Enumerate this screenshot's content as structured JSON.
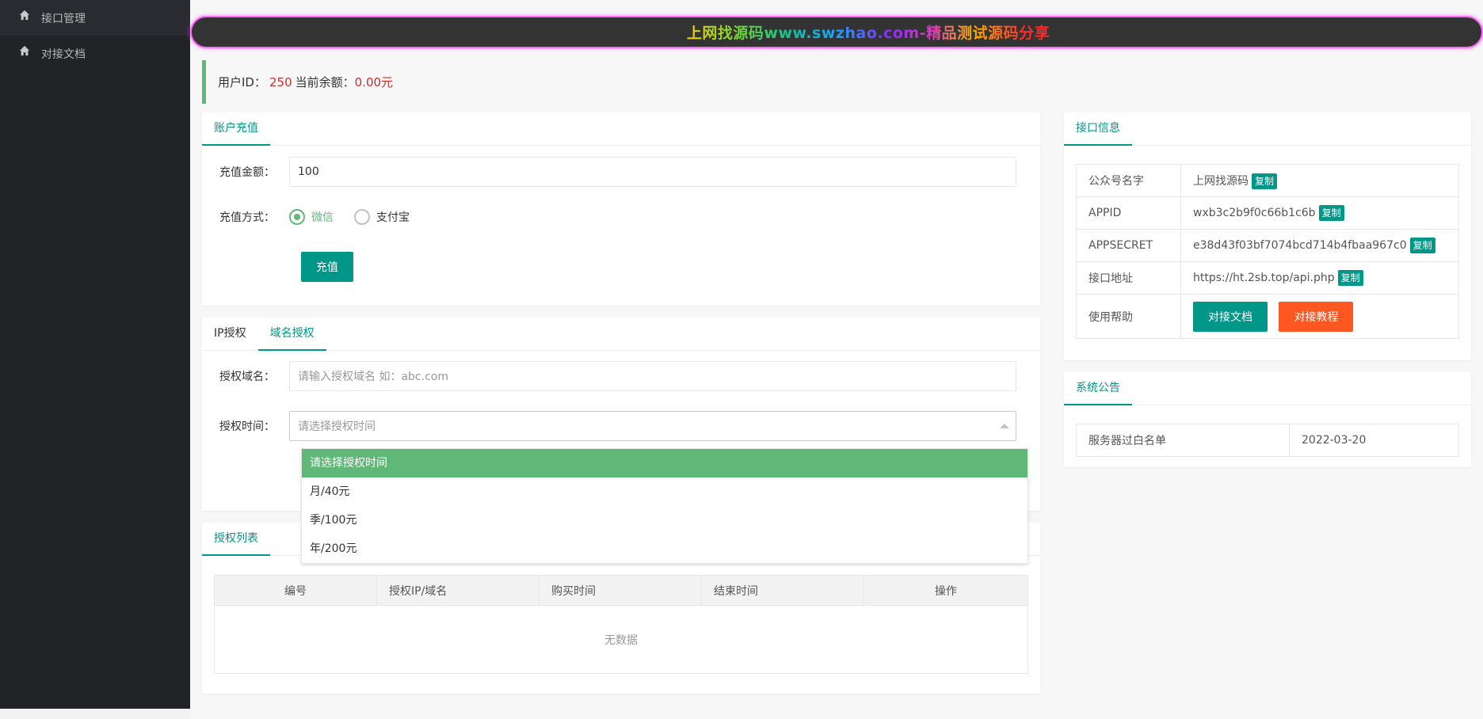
{
  "sidebar": {
    "items": [
      {
        "label": "接口管理"
      },
      {
        "label": "对接文档"
      }
    ]
  },
  "banner": {
    "text": "上网找源码www.swzhao.com-精品测试源码分享"
  },
  "user": {
    "id_label": "用户ID：",
    "id_value": "250",
    "balance_label": "当前余额：",
    "balance_value": "0.00元"
  },
  "recharge": {
    "tab": "账户充值",
    "amount_label": "充值金额：",
    "amount_value": "100",
    "method_label": "充值方式：",
    "methods": [
      "微信",
      "支付宝"
    ],
    "selected_method": "微信",
    "submit_label": "充值"
  },
  "auth": {
    "tabs": [
      "IP授权",
      "域名授权"
    ],
    "active_tab": "域名授权",
    "domain_label": "授权域名：",
    "domain_placeholder": "请输入授权域名 如：abc.com",
    "time_label": "授权时间：",
    "time_placeholder": "请选择授权时间",
    "time_options": [
      "请选择授权时间",
      "月/40元",
      "季/100元",
      "年/200元"
    ]
  },
  "auth_list": {
    "tab": "授权列表",
    "columns": [
      "编号",
      "授权IP/域名",
      "购买时间",
      "结束时间",
      "操作"
    ],
    "empty_text": "无数据"
  },
  "api_info": {
    "tab": "接口信息",
    "copy_label": "复制",
    "rows": [
      {
        "key": "公众号名字",
        "value": "上网找源码"
      },
      {
        "key": "APPID",
        "value": "wxb3c2b9f0c66b1c6b"
      },
      {
        "key": "APPSECRET",
        "value": "e38d43f03bf7074bcd714b4fbaa967c0"
      },
      {
        "key": "接口地址",
        "value": "https://ht.2sb.top/api.php"
      }
    ],
    "help_label": "使用帮助",
    "doc_button": "对接文档",
    "tutorial_button": "对接教程"
  },
  "notice": {
    "tab": "系统公告",
    "rows": [
      {
        "title": "服务器过白名单",
        "date": "2022-03-20"
      }
    ]
  },
  "colors": {
    "accent": "#009688",
    "green": "#5fb878",
    "orange": "#ff5722",
    "sidebar": "#222327"
  }
}
